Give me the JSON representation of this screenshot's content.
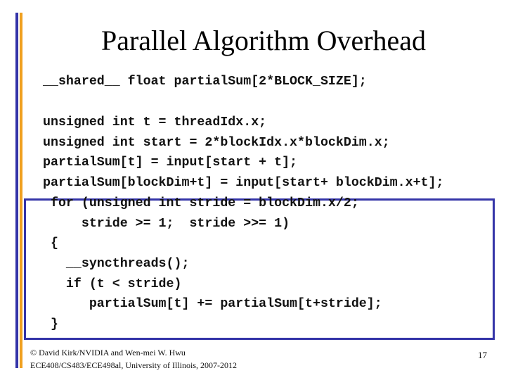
{
  "slide": {
    "title": "Parallel Algorithm Overhead",
    "accent_colors": {
      "bar_primary": "#3434a8",
      "bar_secondary": "#f0a020",
      "box_border": "#3434a8"
    },
    "code_top": [
      "__shared__ float partialSum[2*BLOCK_SIZE];",
      "",
      "unsigned int t = threadIdx.x;",
      "unsigned int start = 2*blockIdx.x*blockDim.x;",
      "partialSum[t] = input[start + t];",
      "partialSum[blockDim+t] = input[start+ blockDim.x+t];"
    ],
    "code_boxed": [
      " for (unsigned int stride = blockDim.x/2;",
      "     stride >= 1;  stride >>= 1)",
      " {",
      "   __syncthreads();",
      "   if (t < stride)",
      "      partialSum[t] += partialSum[t+stride];",
      " }"
    ],
    "footer": {
      "line1": "© David Kirk/NVIDIA and Wen-mei W. Hwu",
      "line2": "ECE408/CS483/ECE498al, University of Illinois, 2007-2012"
    },
    "page_number": "17"
  }
}
